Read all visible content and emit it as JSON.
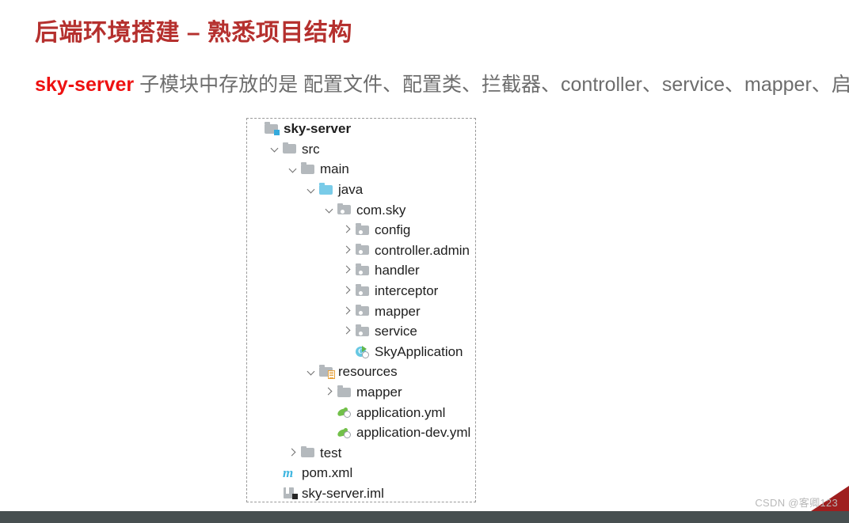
{
  "slide": {
    "title": "后端环境搭建 – 熟悉项目结构",
    "title_color": "#b5302e",
    "subtitle": {
      "accent": "sky-server",
      "accent_color": "#ee1111",
      "rest": " 子模块中存放的是 配置文件、配置类、拦截器、controller、service、mapper、启动类等",
      "rest_color": "#6d6d6d"
    }
  },
  "tree": {
    "rows": [
      {
        "label": "sky-server",
        "depth": 0,
        "chevron": "none",
        "icon": "folder-module-icon",
        "bold": true
      },
      {
        "label": "src",
        "depth": 1,
        "chevron": "down",
        "icon": "folder-icon",
        "bold": false
      },
      {
        "label": "main",
        "depth": 2,
        "chevron": "down",
        "icon": "folder-icon",
        "bold": false
      },
      {
        "label": "java",
        "depth": 3,
        "chevron": "down",
        "icon": "folder-sources-icon",
        "bold": false
      },
      {
        "label": "com.sky",
        "depth": 4,
        "chevron": "down",
        "icon": "package-icon",
        "bold": false
      },
      {
        "label": "config",
        "depth": 5,
        "chevron": "right",
        "icon": "package-icon",
        "bold": false
      },
      {
        "label": "controller.admin",
        "depth": 5,
        "chevron": "right",
        "icon": "package-icon",
        "bold": false
      },
      {
        "label": "handler",
        "depth": 5,
        "chevron": "right",
        "icon": "package-icon",
        "bold": false
      },
      {
        "label": "interceptor",
        "depth": 5,
        "chevron": "right",
        "icon": "package-icon",
        "bold": false
      },
      {
        "label": "mapper",
        "depth": 5,
        "chevron": "right",
        "icon": "package-icon",
        "bold": false
      },
      {
        "label": "service",
        "depth": 5,
        "chevron": "right",
        "icon": "package-icon",
        "bold": false
      },
      {
        "label": "SkyApplication",
        "depth": 5,
        "chevron": "none",
        "icon": "java-class-runnable-icon",
        "bold": false
      },
      {
        "label": "resources",
        "depth": 3,
        "chevron": "down",
        "icon": "folder-resources-icon",
        "bold": false
      },
      {
        "label": "mapper",
        "depth": 4,
        "chevron": "right",
        "icon": "folder-icon",
        "bold": false
      },
      {
        "label": "application.yml",
        "depth": 4,
        "chevron": "none",
        "icon": "spring-yml-icon",
        "bold": false
      },
      {
        "label": "application-dev.yml",
        "depth": 4,
        "chevron": "none",
        "icon": "spring-yml-icon",
        "bold": false
      },
      {
        "label": "test",
        "depth": 2,
        "chevron": "right",
        "icon": "folder-icon",
        "bold": false
      },
      {
        "label": "pom.xml",
        "depth": 1,
        "chevron": "none",
        "icon": "maven-icon",
        "bold": false
      },
      {
        "label": "sky-server.iml",
        "depth": 1,
        "chevron": "none",
        "icon": "iml-module-icon",
        "bold": false
      }
    ]
  },
  "watermark": {
    "text": "CSDN @客卿123"
  }
}
